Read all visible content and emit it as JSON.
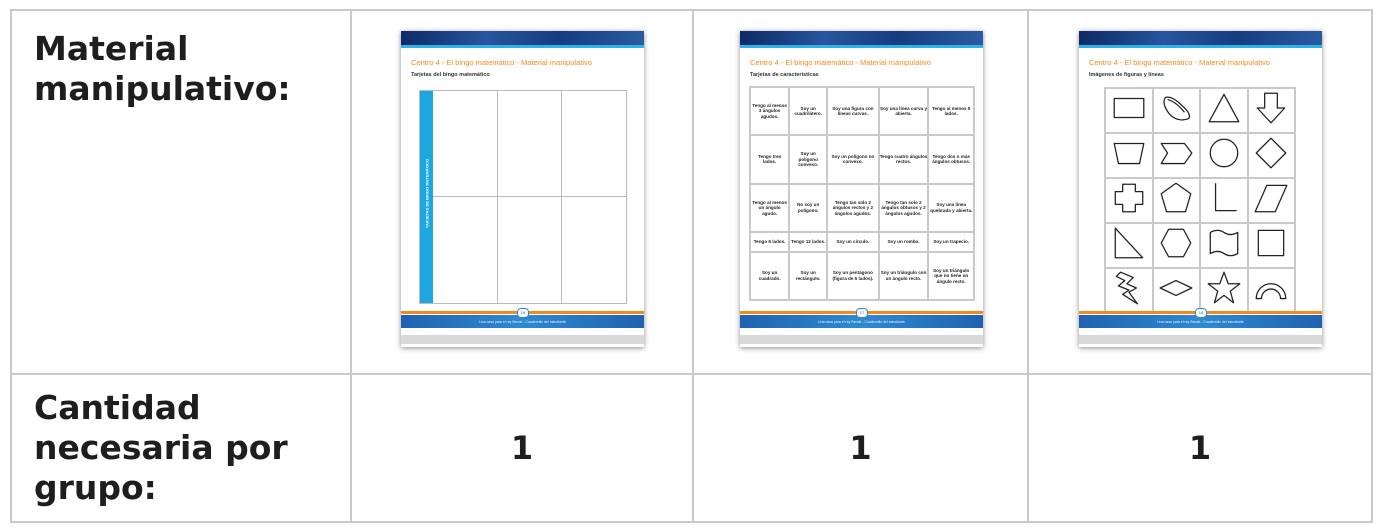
{
  "table": {
    "row1_header": "Material manipulativo:",
    "row2_header": "Cantidad necesaria por grupo:",
    "quantities": [
      "1",
      "1",
      "1"
    ]
  },
  "thumbnails": [
    {
      "title": "Centro 4 - El bingo matemático - Material manipulativo",
      "subtitle": "Tarjetas del bingo matemático",
      "side_label": "TARJETAS DE BINGO MATEMÁTICO",
      "page_number": "16"
    },
    {
      "title": "Centro 4 - El bingo matemático - Material manipulativo",
      "subtitle": "Tarjetas de características",
      "page_number": "17",
      "cards": [
        [
          "Tengo al menos 3 ángulos agudos.",
          "Soy un cuadrilátero.",
          "Soy una figura con líneas curvas.",
          "Soy una línea curva y abierta.",
          "Tengo al menos 5 lados."
        ],
        [
          "Tengo tres lados.",
          "Soy un polígono convexo.",
          "Soy un polígono no convexo.",
          "Tengo cuatro ángulos rectos.",
          "Tengo dos o más ángulos obtusos."
        ],
        [
          "Tengo al menos un ángulo agudo.",
          "No soy un polígono.",
          "Tengo tan solo 2 ángulos rectos y 2 ángulos agudos.",
          "Tengo tan solo 2 ángulos obtusos y 2 ángulos agudos.",
          "Soy una línea quebrada y abierta."
        ],
        [
          "Tengo 6 lados.",
          "Tengo 12 lados.",
          "Soy un círculo.",
          "Soy un rombo.",
          "Soy un trapecio."
        ],
        [
          "Soy un cuadrado.",
          "Soy un rectángulo.",
          "Soy un pentágono (figura de 5 lados).",
          "Soy un triángulo con un ángulo recto.",
          "Soy un triángulo que no tiene un ángulo recto."
        ]
      ]
    },
    {
      "title": "Centro 4 - El bingo matemático - Material manipulativo",
      "subtitle": "Imágenes de figuras y líneas",
      "page_number": "18",
      "shapes": [
        [
          "rectangle",
          "oval-curve",
          "triangle",
          "arrow-down"
        ],
        [
          "trapezoid",
          "chevron-pentagon",
          "circle",
          "rhombus"
        ],
        [
          "cross",
          "pentagon",
          "l-shape-line",
          "parallelogram"
        ],
        [
          "right-triangle",
          "hexagon",
          "wave-flag",
          "square"
        ],
        [
          "lightning-bolt",
          "flat-rhombus",
          "star",
          "arch"
        ]
      ]
    }
  ],
  "footer_text": "Una casa para el rey Benoit - Cuadernillo del estudiante"
}
